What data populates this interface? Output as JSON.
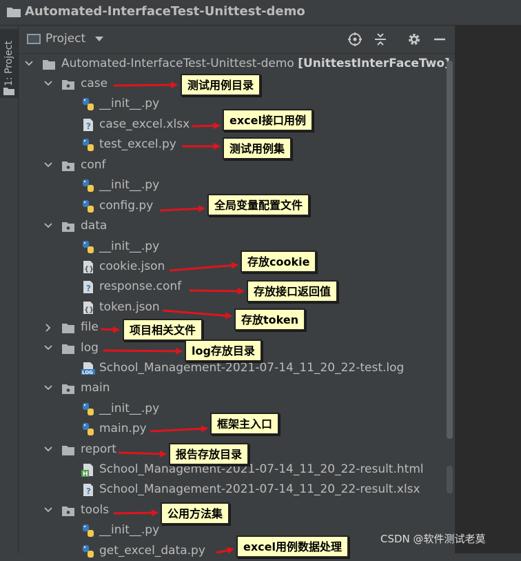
{
  "window": {
    "title": "Automated-InterfaceTest-Unittest-demo"
  },
  "side_tab": {
    "label": "1: Project"
  },
  "panel": {
    "title": "Project"
  },
  "tree": {
    "root": {
      "name": "Automated-InterfaceTest-Unittest-demo",
      "module": "[UnittestInterFaceTwo]",
      "overflow": "F"
    },
    "rows": [
      {
        "name": "case",
        "kind": "package",
        "expanded": true
      },
      {
        "name": "__init__.py",
        "kind": "python"
      },
      {
        "name": "case_excel.xlsx",
        "kind": "unknown"
      },
      {
        "name": "test_excel.py",
        "kind": "python"
      },
      {
        "name": "conf",
        "kind": "package",
        "expanded": true
      },
      {
        "name": "__init__.py",
        "kind": "python"
      },
      {
        "name": "config.py",
        "kind": "python"
      },
      {
        "name": "data",
        "kind": "package",
        "expanded": true
      },
      {
        "name": "__init__.py",
        "kind": "python"
      },
      {
        "name": "cookie.json",
        "kind": "json"
      },
      {
        "name": "response.conf",
        "kind": "unknown"
      },
      {
        "name": "token.json",
        "kind": "json"
      },
      {
        "name": "file",
        "kind": "folder",
        "expanded": false
      },
      {
        "name": "log",
        "kind": "folder",
        "expanded": true
      },
      {
        "name": "School_Management-2021-07-14_11_20_22-test.log",
        "kind": "log",
        "file_badge": "LOG"
      },
      {
        "name": "main",
        "kind": "package",
        "expanded": true
      },
      {
        "name": "__init__.py",
        "kind": "python"
      },
      {
        "name": "main.py",
        "kind": "python"
      },
      {
        "name": "report",
        "kind": "folder",
        "expanded": true
      },
      {
        "name": "School_Management-2021-07-14_11_20_22-result.html",
        "kind": "html",
        "file_badge": "H"
      },
      {
        "name": "School_Management-2021-07-14_11_20_22-result.xlsx",
        "kind": "unknown"
      },
      {
        "name": "tools",
        "kind": "package",
        "expanded": true
      },
      {
        "name": "__init__.py",
        "kind": "python"
      },
      {
        "name": "get_excel_data.py",
        "kind": "python"
      }
    ]
  },
  "annotations": [
    {
      "text": "测试用例目录"
    },
    {
      "text": "excel接口用例"
    },
    {
      "text": "测试用例集"
    },
    {
      "text": "全局变量配置文件"
    },
    {
      "text": "存放cookie"
    },
    {
      "text": "存放接口返回值"
    },
    {
      "text": "存放token"
    },
    {
      "text": "项目相关文件"
    },
    {
      "text": "log存放目录"
    },
    {
      "text": "框架主入口"
    },
    {
      "text": "报告存放目录"
    },
    {
      "text": "公用方法集"
    },
    {
      "text": "excel用例数据处理"
    }
  ],
  "watermark": "CSDN @软件测试老莫",
  "colors": {
    "panel_bg": "#3c3f41",
    "editor_bg": "#2b2b2b",
    "text": "#bbbbbb",
    "note_bg": "#ffffc0",
    "arrow": "#e0141e",
    "python_blue": "#3b7bbf",
    "python_yellow": "#f2c94c"
  }
}
